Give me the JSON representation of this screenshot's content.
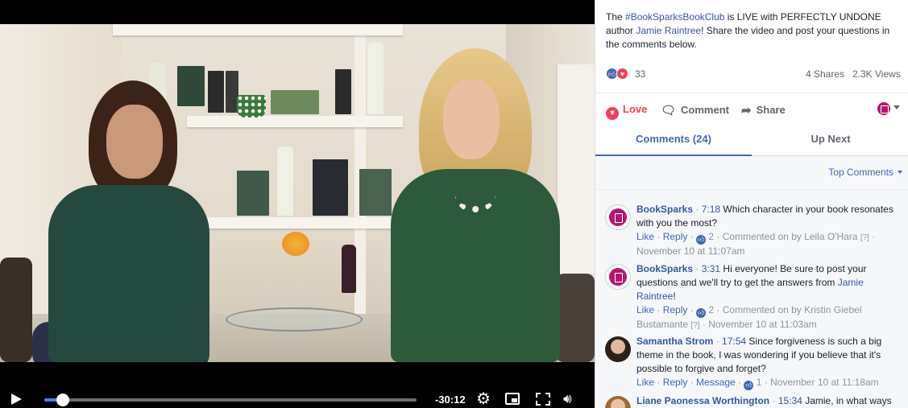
{
  "video": {
    "time_remaining": "-30:12",
    "progress_fraction": 0.05
  },
  "post": {
    "text_prefix": "The ",
    "hashtag": "#BookSparksBookClub",
    "text_middle": " is LIVE with PERFECTLY UNDONE author ",
    "author_link": "Jamie Raintree",
    "text_suffix": "! Share the video and post your questions in the comments below.",
    "reaction_count": "33",
    "shares": "4 Shares",
    "views": "2.3K Views"
  },
  "actions": {
    "love": "Love",
    "comment": "Comment",
    "share": "Share"
  },
  "tabs": {
    "comments": "Comments (24)",
    "up_next": "Up Next"
  },
  "feed": {
    "sort_label": "Top Comments"
  },
  "comments": [
    {
      "author": "BookSparks",
      "time": "7:18",
      "text": "Which character in your book resonates with you the most?",
      "like": "Like",
      "reply": "Reply",
      "reactions": "2",
      "meta": "Commented on by Leila O'Hara",
      "help": "[?]",
      "date": "November 10 at 11:07am"
    },
    {
      "author": "BookSparks",
      "time": "3:31",
      "text_prefix": "Hi everyone! Be sure to post your questions and we'll try to get the answers from ",
      "text_link": "Jamie Raintree",
      "text_suffix": "!",
      "like": "Like",
      "reply": "Reply",
      "reactions": "2",
      "meta_prefix": "Commented on by Kristin Giebel",
      "meta_name2": "Bustamante",
      "help": "[?]",
      "date": "November 10 at 11:03am"
    },
    {
      "author": "Samantha Strom",
      "time": "17:54",
      "text": "Since forgiveness is such a big theme in the book, I was wondering if you believe that it's possible to forgive and forget?",
      "like": "Like",
      "reply": "Reply",
      "message": "Message",
      "reactions": "1",
      "date": "November 10 at 11:18am"
    },
    {
      "author": "Liane Paonessa Worthington",
      "time": "15:34",
      "text": "Jamie, in what ways"
    }
  ],
  "colors": {
    "facebook_blue": "#4267b2",
    "link_blue": "#365899",
    "love_red": "#f33e58",
    "progress_blue": "#4b7bec"
  }
}
